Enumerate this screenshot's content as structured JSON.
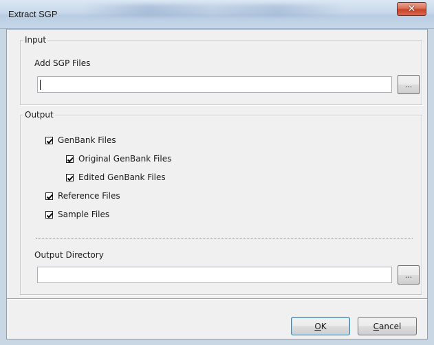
{
  "window": {
    "title": "Extract SGP",
    "close_glyph": "✕"
  },
  "input_group": {
    "legend": "Input",
    "add_label": "Add SGP Files",
    "field_value": "",
    "browse_label": "..."
  },
  "output_group": {
    "legend": "Output",
    "checkboxes": [
      {
        "label": "GenBank Files",
        "checked": true
      },
      {
        "label": "Original GenBank Files",
        "checked": true
      },
      {
        "label": "Edited GenBank Files",
        "checked": true
      },
      {
        "label": "Reference Files",
        "checked": true
      },
      {
        "label": "Sample Files",
        "checked": true
      }
    ],
    "dir_label": "Output Directory",
    "dir_value": "",
    "browse_label": "..."
  },
  "buttons": {
    "ok": "OK",
    "cancel": "Cancel"
  },
  "colors": {
    "dialog_bg": "#f0f0f0",
    "close_button": "#c7442a",
    "default_button_border": "#3c7fb1"
  }
}
